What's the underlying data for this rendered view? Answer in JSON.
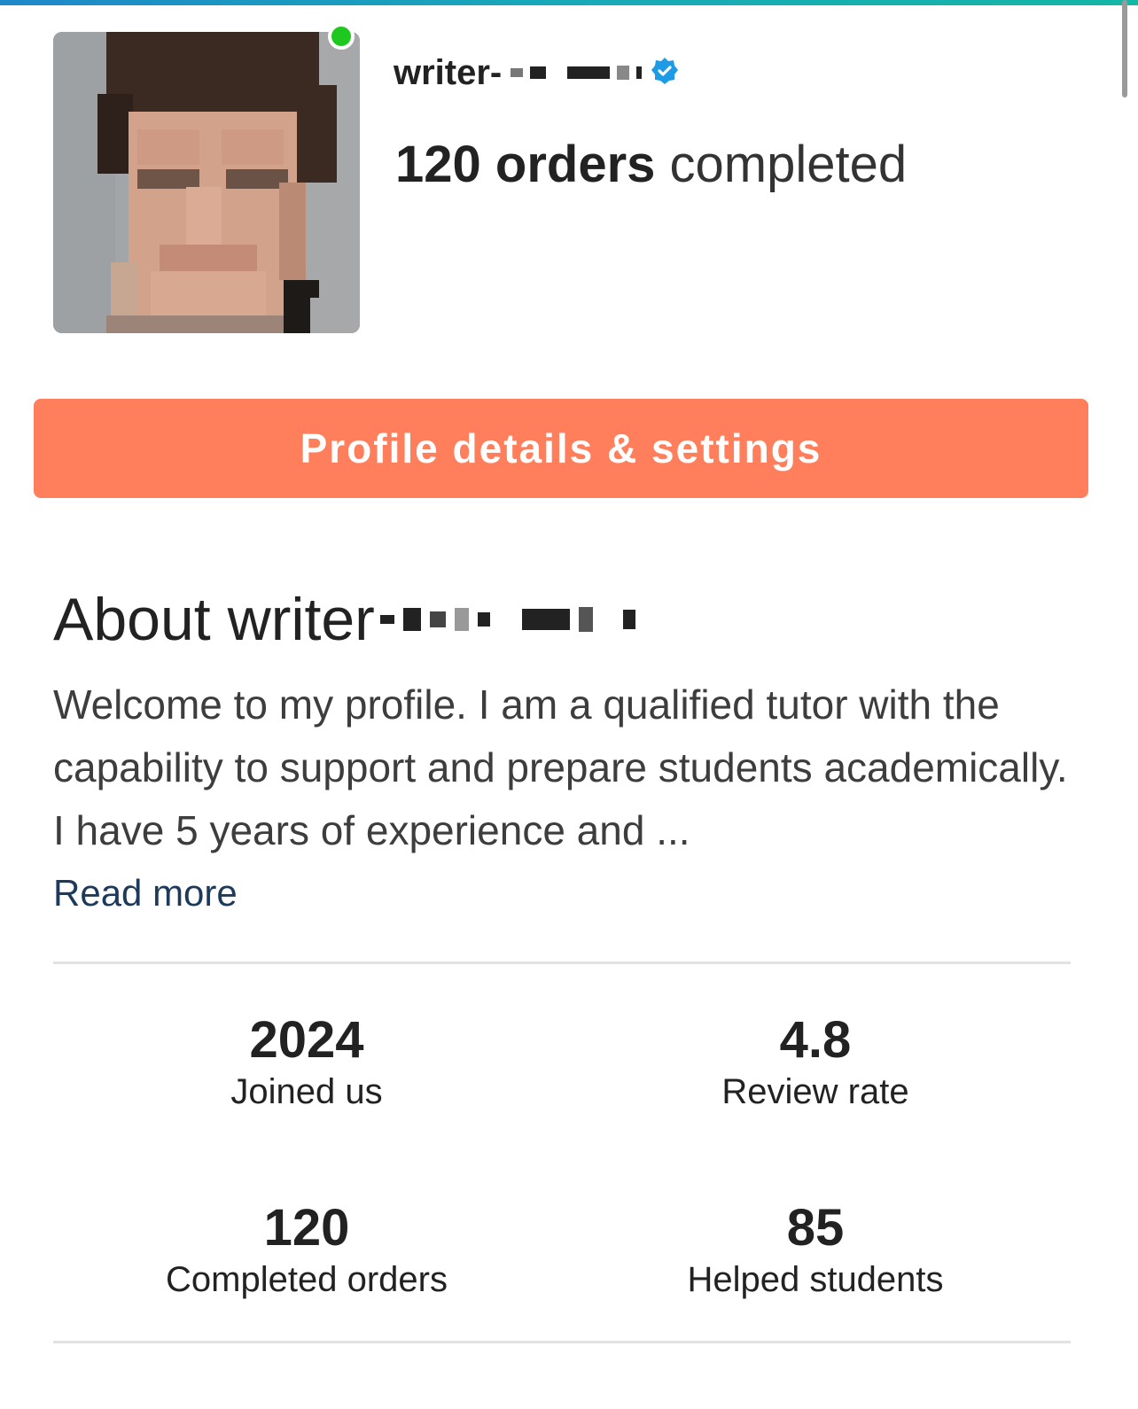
{
  "profile": {
    "name_prefix": "writer-",
    "orders_count_label": "120 orders",
    "orders_suffix": "completed"
  },
  "actions": {
    "profile_settings_label": "Profile details & settings"
  },
  "about": {
    "title_prefix": "About writer",
    "body": "Welcome to my profile. I am a qualified tutor with the capability to support and prepare students academically. I have 5 years of experience and ...",
    "read_more_label": "Read more"
  },
  "stats": [
    {
      "value": "2024",
      "label": "Joined us"
    },
    {
      "value": "4.8",
      "label": "Review rate"
    },
    {
      "value": "120",
      "label": "Completed orders"
    },
    {
      "value": "85",
      "label": "Helped students"
    }
  ],
  "colors": {
    "button": "#ff7f5c",
    "online": "#1ec81e",
    "verified": "#1e9be6",
    "link": "#1e3a5a"
  },
  "icons": {
    "verified": "verified-badge-icon",
    "online": "online-status-dot"
  }
}
